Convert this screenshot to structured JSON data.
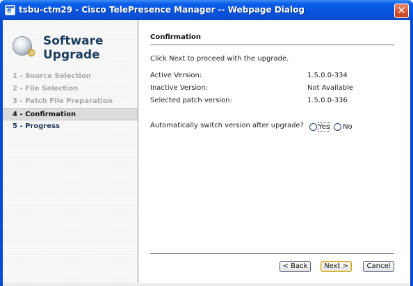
{
  "window": {
    "title": "tsbu-ctm29 - Cisco TelePresence Manager -- Webpage Dialog",
    "close_label": "✕"
  },
  "sidebar": {
    "title_line1": "Software",
    "title_line2": "Upgrade",
    "steps": [
      {
        "label": "1 - Source Selection",
        "state": "completed"
      },
      {
        "label": "2 - File Selection",
        "state": "completed"
      },
      {
        "label": "3 - Patch File Preparation",
        "state": "completed"
      },
      {
        "label": "4 - Confirmation",
        "state": "current"
      },
      {
        "label": "5 - Progress",
        "state": "upcoming"
      }
    ]
  },
  "main": {
    "heading": "Confirmation",
    "intro": "Click Next to proceed with the upgrade.",
    "rows": [
      {
        "label": "Active Version:",
        "value": "1.5.0.0-334"
      },
      {
        "label": "Inactive Version:",
        "value": "Not Available"
      },
      {
        "label": "Selected patch version:",
        "value": "1.5.0.0-336"
      }
    ],
    "auto_switch": {
      "label": "Automatically switch version after upgrade?",
      "options": [
        "Yes",
        "No"
      ],
      "selected": null
    }
  },
  "buttons": {
    "back": "< Back",
    "next": "Next >",
    "cancel": "Cancel"
  }
}
